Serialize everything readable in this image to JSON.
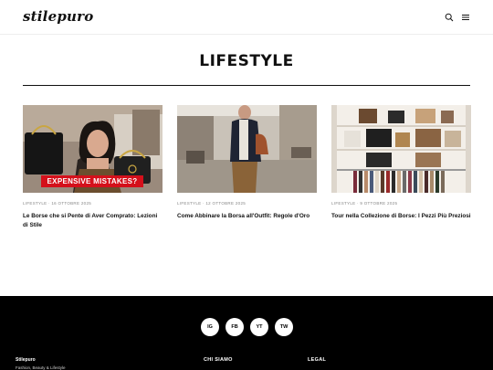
{
  "header": {
    "logo": "stilepuro",
    "search_icon": "search-icon",
    "menu_icon": "menu-icon"
  },
  "page": {
    "title": "LIFESTYLE"
  },
  "articles": [
    {
      "meta": "LIFESTYLE · 16 OTTOBRE 2025",
      "title": "Le Borse che si Pente di Aver Comprato: Lezioni di Stile",
      "overlay": "EXPENSIVE MISTAKES?"
    },
    {
      "meta": "LIFESTYLE · 12 OTTOBRE 2025",
      "title": "Come Abbinare la Borsa all'Outfit: Regole d'Oro"
    },
    {
      "meta": "LIFESTYLE · 9 OTTOBRE 2025",
      "title": "Tour nella Collezione di Borse: I Pezzi Più Preziosi"
    }
  ],
  "footer": {
    "social": [
      "IG",
      "FB",
      "YT",
      "TW"
    ],
    "brand": "Stilepuro",
    "tagline": "Fashion, Beauty & Lifestyle",
    "col_about": "CHI SIAMO",
    "col_legal": "LEGAL"
  },
  "colors": {
    "footer_bg": "#000000",
    "overlay_red": "#d4101b"
  }
}
